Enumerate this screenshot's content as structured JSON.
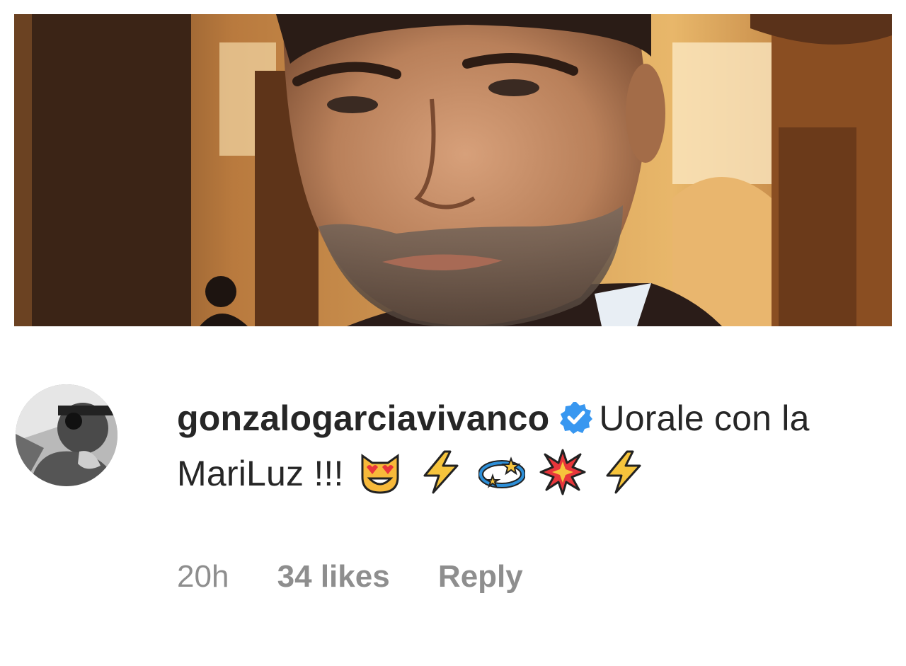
{
  "comment": {
    "username": "gonzalogarciavivanco",
    "verified": true,
    "text": "Uorale con la MariLuz !!!",
    "emojis": [
      "heart-eyes-cat",
      "high-voltage",
      "dizzy",
      "collision",
      "high-voltage"
    ],
    "timestamp": "20h",
    "likes": "34 likes",
    "reply_label": "Reply"
  },
  "colors": {
    "text": "#262626",
    "muted": "#8e8e8e",
    "verified_badge": "#3897f0",
    "photo_warm": "#c98a4a"
  },
  "icons": {
    "verified": "verified-badge-icon",
    "avatar": "avatar-image"
  }
}
